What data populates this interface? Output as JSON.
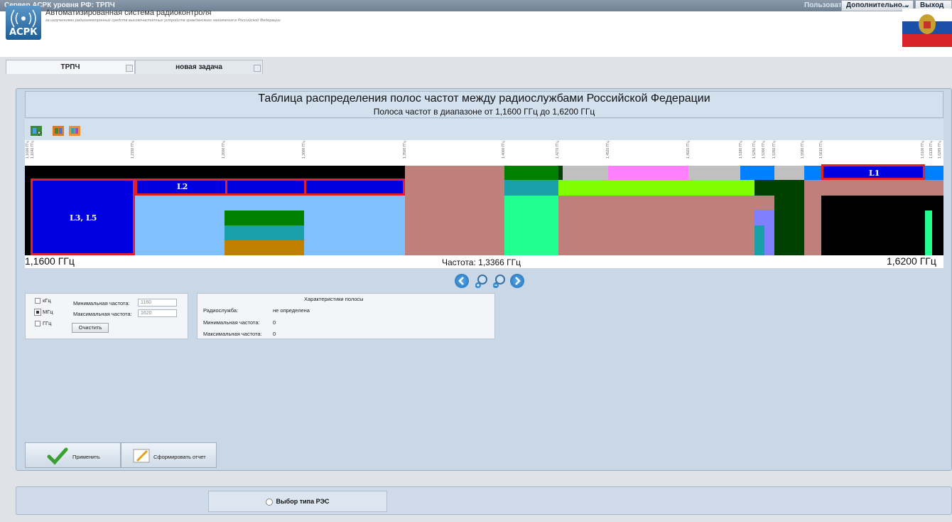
{
  "topbar": {
    "title": "Сервер АСРК уровня РФ:   ТРПЧ",
    "user": "Пользователь: sa",
    "more_button": "Дополнительно...",
    "exit_button": "Выход"
  },
  "header": {
    "logo_text": "АСРК",
    "app_title": "Автоматизированная система радиоконтроля",
    "app_subtitle": "за излучениями радиоэлектронных средств высокочастотных устройств гражданского назначения в Российской Федерации"
  },
  "tabs": [
    {
      "label": "ТРПЧ"
    },
    {
      "label": "новая задача"
    }
  ],
  "chart": {
    "title": "Таблица распределения полос частот между радиослужбами Российской Федерации",
    "subtitle": "Полоса частот в диапазоне от 1,1600 ГГц до 1,6200 ГГц",
    "freq_min": "1,1600 ГГц",
    "freq_max": "1,6200 ГГц",
    "freq_current": "Частота: 1,3366 ГГц",
    "ticks": [
      "1,1600 ГГц",
      "1,1640 ГГц",
      "1,2150 ГГц",
      "1,2600 ГГц",
      "1,3000 ГГц",
      "1,3500 ГГц",
      "1,4000 ГГц",
      "1,4270 ГГц",
      "1,4520 ГГц",
      "1,4920 ГГц",
      "1,5180 ГГц",
      "1,5250 ГГц",
      "1,5300 ГГц",
      "1,5350 ГГц",
      "1,5590 ГГц",
      "1,5610 ГГц",
      "1,6100 ГГц",
      "1,6139 ГГц",
      "1,6265 ГГц"
    ],
    "labels": {
      "l1": "L1",
      "l2": "L2",
      "l35": "L3, L5"
    }
  },
  "units": {
    "khz": "кГц",
    "mhz": "МГц",
    "ghz": "ГГц",
    "min_label": "Минимальная частота:",
    "max_label": "Максимальная частота:",
    "min_value": "1160",
    "max_value": "1620",
    "clear_button": "Очистить"
  },
  "band_info": {
    "title": "Характеристики полосы",
    "service_label": "Радиослужба:",
    "service_value": "не определена",
    "min_label": "Минимальная частота:",
    "min_value": "0",
    "max_label": "Максимальная частота:",
    "max_value": "0"
  },
  "actions": {
    "apply": "Применить",
    "report": "Сформировать отчет"
  },
  "bottom": {
    "res_type": "Выбор типа РЭС"
  }
}
